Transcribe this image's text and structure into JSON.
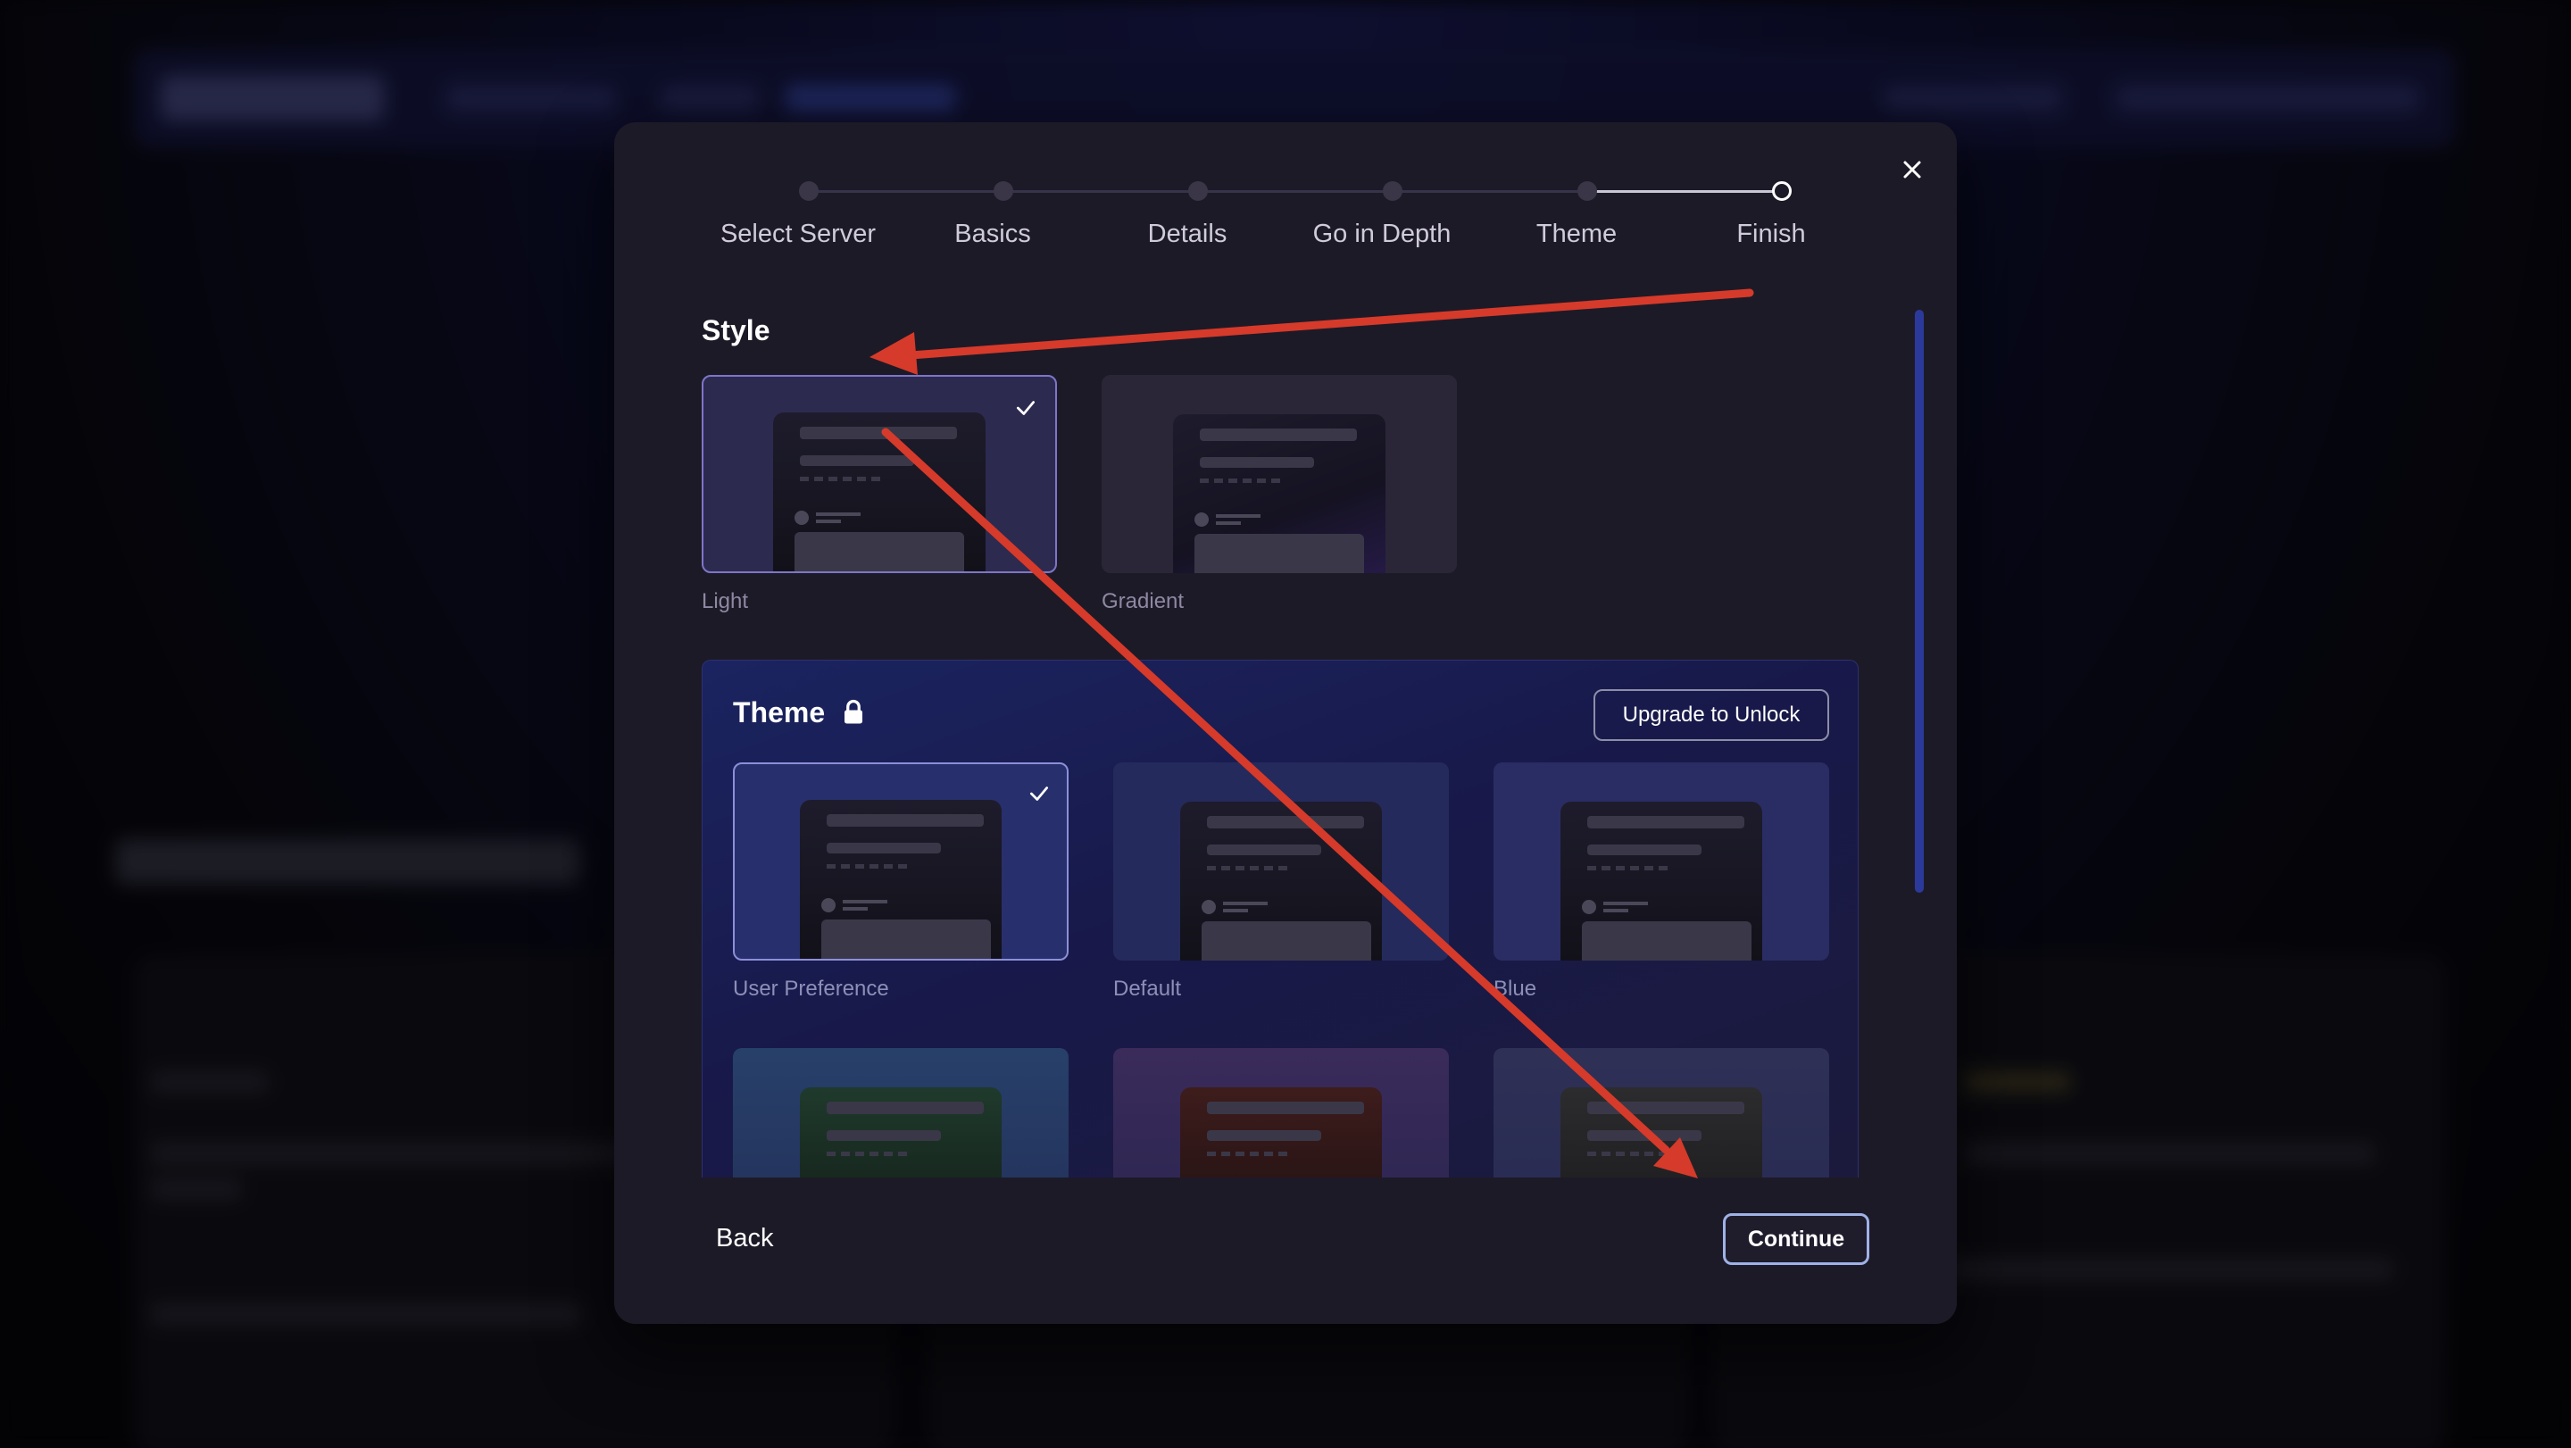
{
  "stepper": {
    "steps": [
      {
        "label": "Select Server",
        "state": "done"
      },
      {
        "label": "Basics",
        "state": "done"
      },
      {
        "label": "Details",
        "state": "done"
      },
      {
        "label": "Go in Depth",
        "state": "done"
      },
      {
        "label": "Theme",
        "state": "done"
      },
      {
        "label": "Finish",
        "state": "current"
      }
    ]
  },
  "style_section": {
    "title": "Style",
    "options": [
      {
        "label": "Light",
        "selected": true
      },
      {
        "label": "Gradient",
        "selected": false
      }
    ]
  },
  "theme_section": {
    "title": "Theme",
    "upgrade_label": "Upgrade to Unlock",
    "options": [
      {
        "label": "User Preference",
        "selected": true
      },
      {
        "label": "Default",
        "selected": false
      },
      {
        "label": "Blue",
        "selected": false
      },
      {
        "label": "",
        "selected": false
      },
      {
        "label": "",
        "selected": false
      },
      {
        "label": "",
        "selected": false
      }
    ]
  },
  "footer": {
    "back_label": "Back",
    "continue_label": "Continue"
  },
  "icons": {
    "close": "close-icon",
    "check": "checkmark-icon",
    "lock": "lock-icon"
  },
  "colors": {
    "annotation_arrow": "#d63a2a",
    "modal_bg": "#1d1a27",
    "accent_selected": "#7d76c8",
    "continue_border": "#9fb2e8"
  }
}
